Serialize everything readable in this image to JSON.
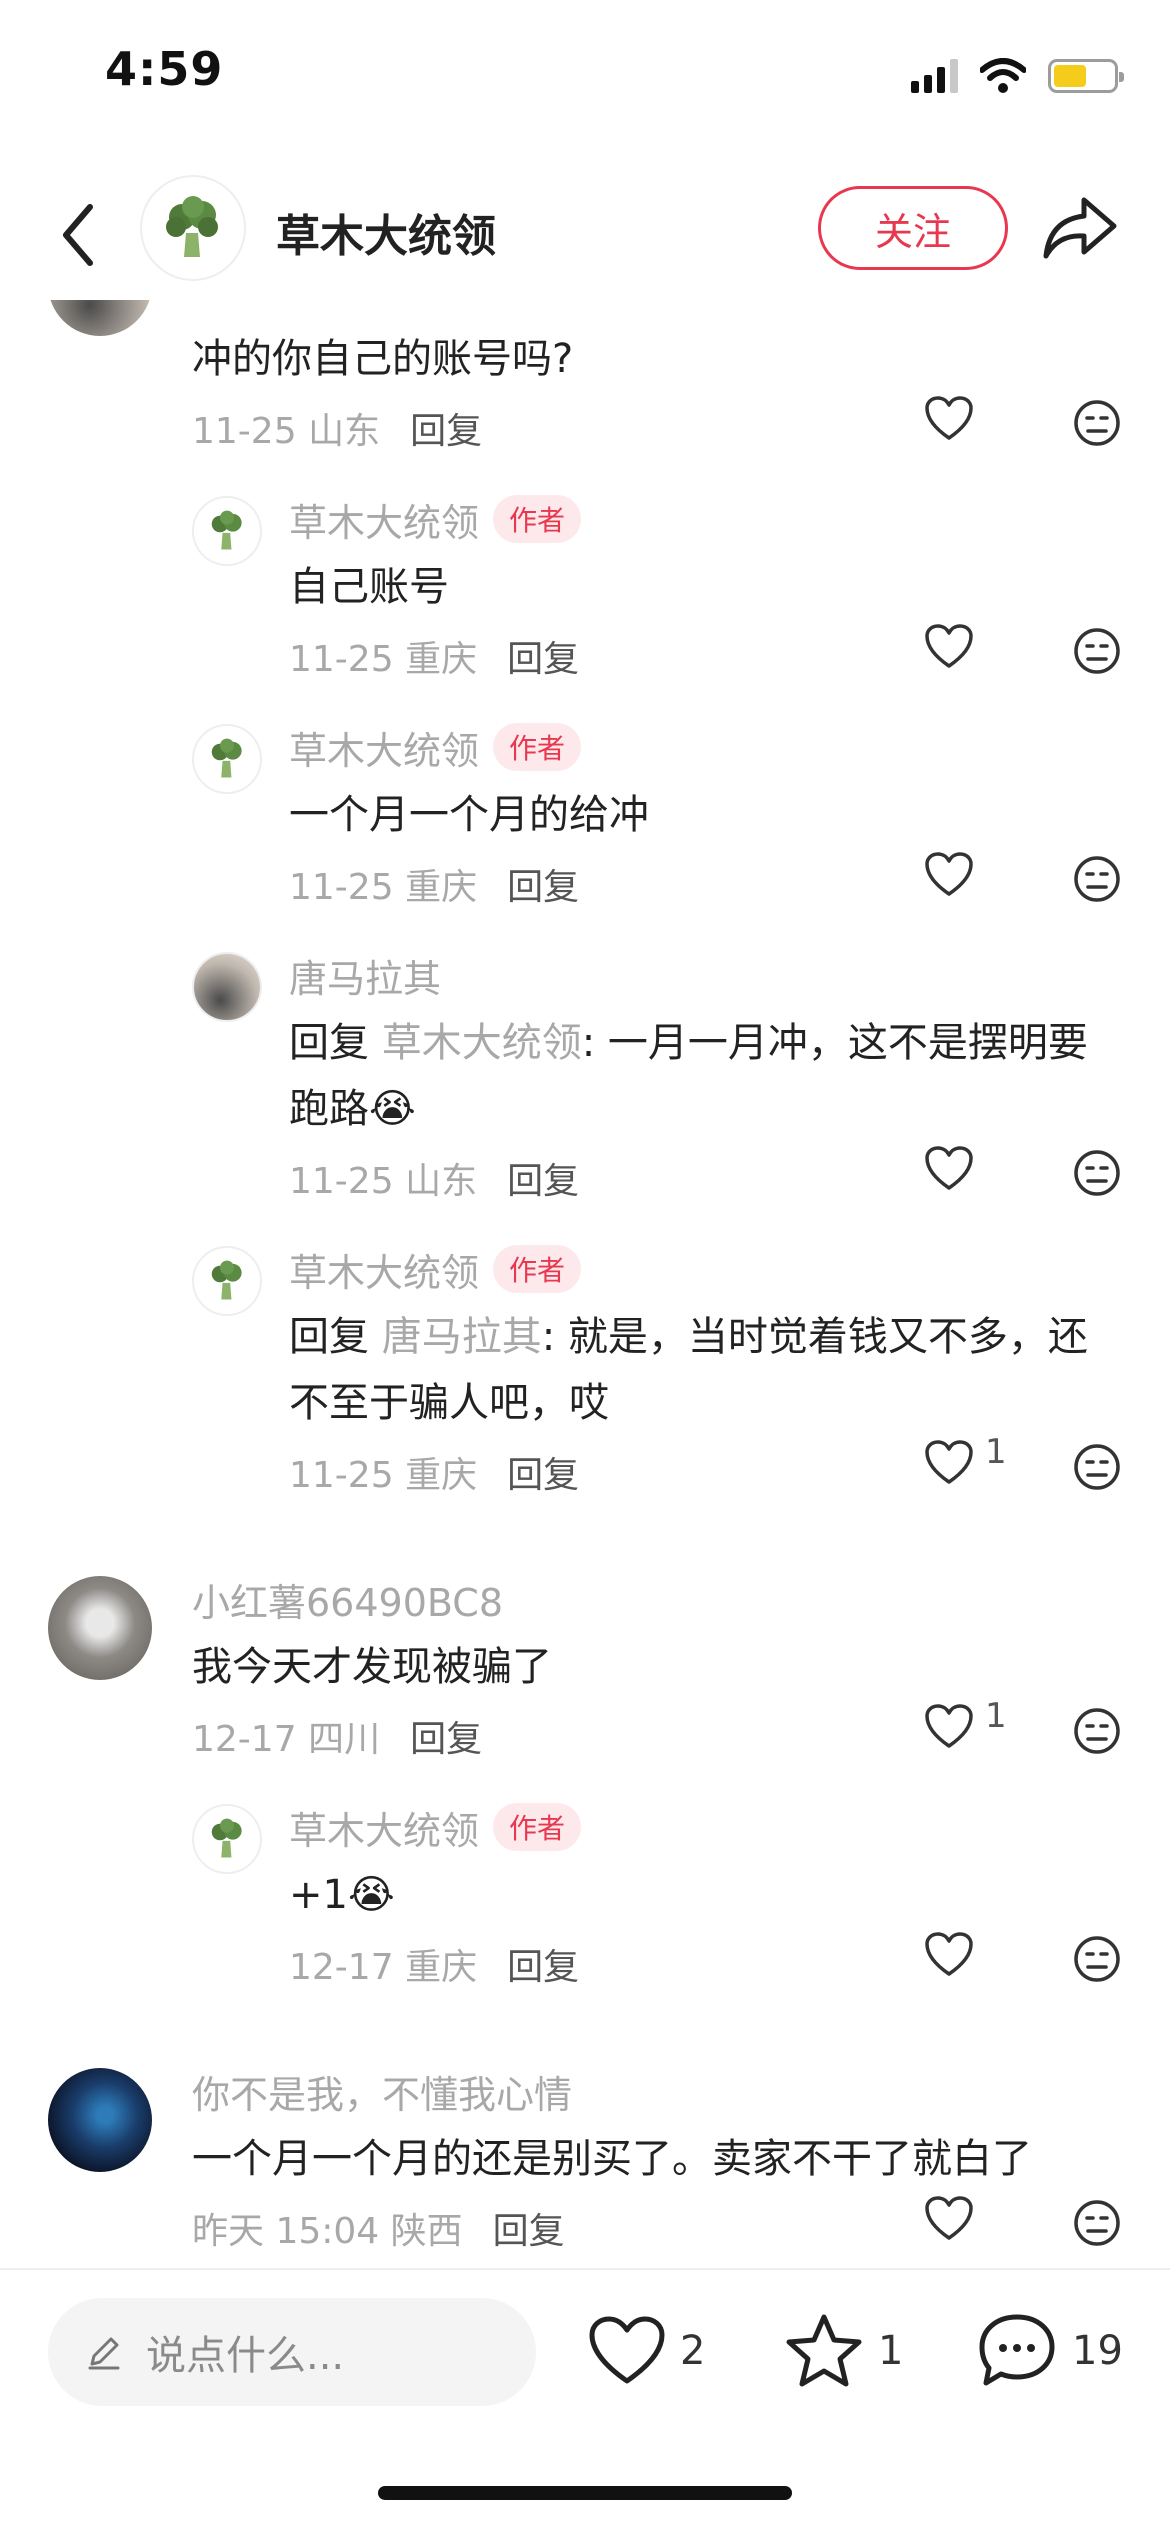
{
  "status_bar": {
    "time": "4:59",
    "battery_color": "#f5cc1c"
  },
  "header": {
    "title": "草木大统领",
    "follow_label": "关注",
    "back_icon": "chevron-left-icon",
    "share_icon": "share-arrow-icon"
  },
  "colors": {
    "accent": "#e8384f",
    "muted": "#a8a8a8"
  },
  "comments": [
    {
      "text": "冲的你自己的账号吗?",
      "date": "11-25",
      "location": "山东",
      "reply": "回复"
    },
    {
      "name": "草木大统领",
      "author_tag": "作者",
      "text": "自己账号",
      "date": "11-25",
      "location": "重庆",
      "reply": "回复"
    },
    {
      "name": "草木大统领",
      "author_tag": "作者",
      "text": "一个月一个月的给冲",
      "date": "11-25",
      "location": "重庆",
      "reply": "回复"
    },
    {
      "name": "唐马拉其",
      "reply_prefix": "回复",
      "reply_to": "草木大统领",
      "text": ": 一月一月冲，这不是摆明要跑路😭",
      "date": "11-25",
      "location": "山东",
      "reply": "回复"
    },
    {
      "name": "草木大统领",
      "author_tag": "作者",
      "reply_prefix": "回复",
      "reply_to": "唐马拉其",
      "text": ": 就是，当时觉着钱又不多，还不至于骗人吧，哎",
      "date": "11-25",
      "location": "重庆",
      "reply": "回复",
      "likes": "1"
    },
    {
      "name": "小红薯66490BC8",
      "text": "我今天才发现被骗了",
      "date": "12-17",
      "location": "四川",
      "reply": "回复",
      "likes": "1"
    },
    {
      "name": "草木大统领",
      "author_tag": "作者",
      "text": "+1😭",
      "date": "12-17",
      "location": "重庆",
      "reply": "回复"
    },
    {
      "name": "你不是我，不懂我心情",
      "text": "一个月一个月的还是别买了。卖家不干了就白了",
      "date": "昨天 15:04",
      "location": "陕西",
      "reply": "回复"
    }
  ],
  "bottom_bar": {
    "placeholder": "说点什么...",
    "likes": "2",
    "favorites": "1",
    "comments": "19"
  }
}
